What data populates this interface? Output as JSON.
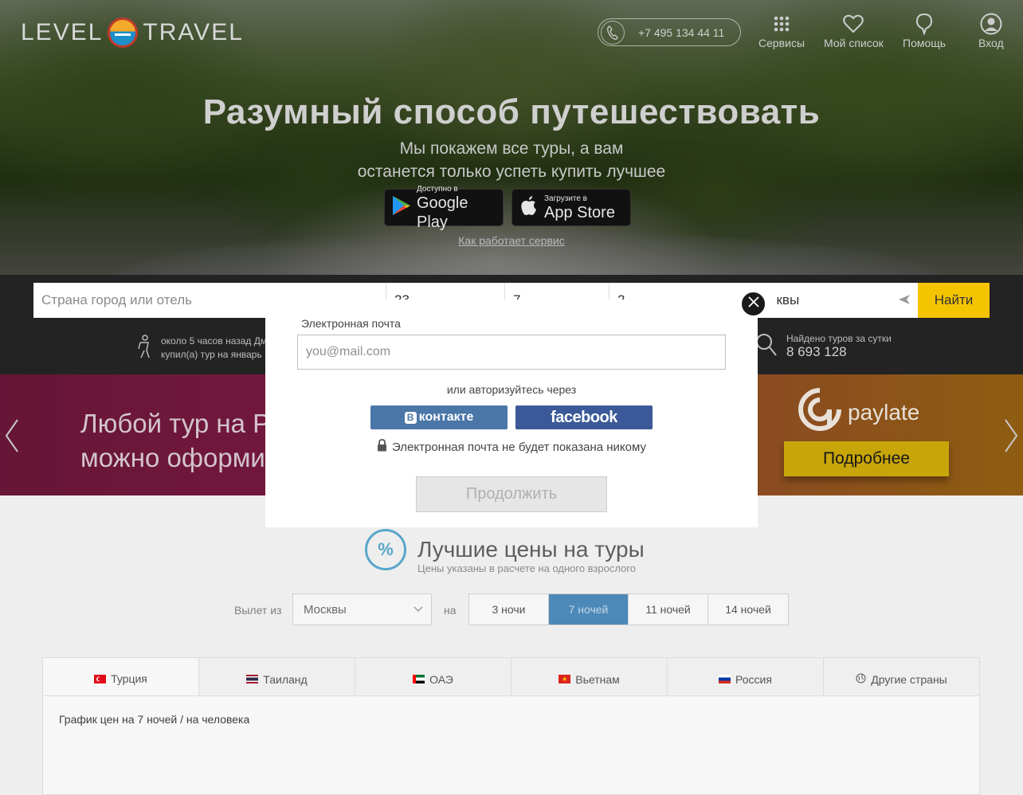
{
  "header": {
    "logo": {
      "left": "LEVEL",
      "right": "TRAVEL"
    },
    "phone": "+7 495 134 44 11",
    "nav": [
      {
        "label": "Сервисы",
        "icon": "grid-icon"
      },
      {
        "label": "Мой список",
        "icon": "heart-icon"
      },
      {
        "label": "Помощь",
        "icon": "help-bubble-icon"
      },
      {
        "label": "Вход",
        "icon": "user-icon"
      }
    ]
  },
  "hero": {
    "title": "Разумный способ путешествовать",
    "subtitle_line1": "Мы покажем все туры, а вам",
    "subtitle_line2": "останется только успеть купить лучшее",
    "google_play": {
      "small": "Доступно в",
      "big": "Google Play"
    },
    "app_store": {
      "small": "Загрузите в",
      "big": "App Store"
    },
    "how_link": "Как работает сервис"
  },
  "search": {
    "destination_placeholder": "Страна город или отель",
    "date_value": "23",
    "nights_value": "7",
    "tourists_value": "2",
    "from_value": "квы",
    "find_button": "Найти",
    "recent_purchase_line1": "около 5 часов назад Дм",
    "recent_purchase_line2": "купил(а) тур на январь",
    "found_label": "Найдено туров за сутки",
    "found_count": "8 693 128"
  },
  "promo": {
    "line1": "Любой тур на Р",
    "line2": "можно оформи",
    "partner": "paylate",
    "more_button": "Подробнее"
  },
  "best_prices": {
    "title": "Лучшие цены на туры",
    "subtitle": "Цены указаны в расчете на одного взрослого",
    "departure_label": "Вылет из",
    "departure_value": "Москвы",
    "on_label": "на",
    "nights": [
      "3 ночи",
      "7 ночей",
      "11 ночей",
      "14 ночей"
    ],
    "active_nights_index": 1,
    "countries": [
      {
        "label": "Турция",
        "flag": "turkey-flag-icon"
      },
      {
        "label": "Таиланд",
        "flag": "thailand-flag-icon"
      },
      {
        "label": "ОАЭ",
        "flag": "uae-flag-icon"
      },
      {
        "label": "Вьетнам",
        "flag": "vietnam-flag-icon"
      },
      {
        "label": "Россия",
        "flag": "russia-flag-icon"
      },
      {
        "label": "Другие страны",
        "flag": "globe-icon"
      }
    ],
    "active_country_index": 0,
    "chart_caption": "График цен на 7 ночей / на человека"
  },
  "modal": {
    "close_label": "закрыть",
    "email_label": "Электронная почта",
    "email_placeholder": "you@mail.com",
    "or_text": "или авторизуйтесь через",
    "vk_label": "контакте",
    "vk_letter": "В",
    "fb_label": "facebook",
    "privacy_text": "Электронная почта не будет показана никому",
    "continue_button": "Продолжить"
  },
  "colors": {
    "accent_yellow": "#f5c400",
    "vk_blue": "#4a76a8",
    "fb_blue": "#3b5998",
    "active_tab_blue": "#4d89b8"
  }
}
